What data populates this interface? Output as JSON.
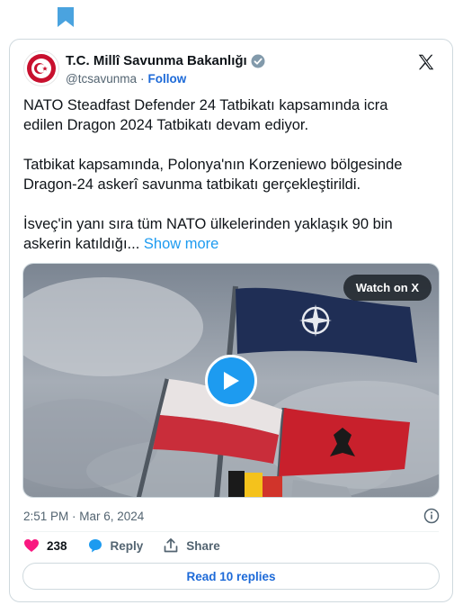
{
  "account": {
    "display_name": "T.C. Millî Savunma Bakanlığı",
    "handle": "@tcsavunma",
    "separator": "·",
    "follow_label": "Follow"
  },
  "tweet": {
    "paragraphs": [
      "NATO Steadfast Defender 24 Tatbikatı kapsamında icra edilen Dragon 2024 Tatbikatı devam ediyor.",
      "Tatbikat kapsamında, Polonya'nın Korzeniewo bölgesinde Dragon-24 askerî savunma tatbikatı gerçekleştirildi."
    ],
    "truncated_text": "İsveç'in yanı sıra tüm NATO ülkelerinden yaklaşık 90 bin askerin katıldığı...",
    "show_more_label": "Show more"
  },
  "media": {
    "watch_label": "Watch on X"
  },
  "meta": {
    "timestamp": "2:51 PM · Mar 6, 2024"
  },
  "actions": {
    "like_count": "238",
    "reply_label": "Reply",
    "share_label": "Share"
  },
  "replies": {
    "read_label": "Read 10 replies"
  },
  "colors": {
    "brand_blue": "#1d9bf0",
    "link_blue": "#1d6ad8",
    "heart_red": "#f91880",
    "muted": "#536471",
    "avatar_red": "#c8102e"
  },
  "icons": [
    "bookmark-icon",
    "verified-icon",
    "x-logo-icon",
    "play-icon",
    "info-icon",
    "heart-icon",
    "reply-icon",
    "share-icon"
  ]
}
